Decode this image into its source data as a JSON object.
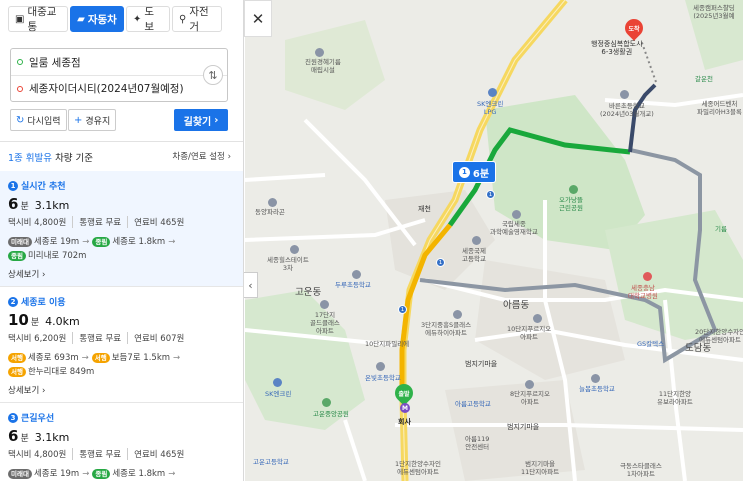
{
  "tabs": [
    {
      "label": "대중교통",
      "icon": "bus-icon",
      "glyph": "▣",
      "active": false
    },
    {
      "label": "자동차",
      "icon": "car-icon",
      "glyph": "▰",
      "active": true
    },
    {
      "label": "도보",
      "icon": "walk-icon",
      "glyph": "🚶",
      "active": false
    },
    {
      "label": "자전거",
      "icon": "bike-icon",
      "glyph": "⚲",
      "active": false
    }
  ],
  "search": {
    "origin": "일룸 세종점",
    "destination": "세종자이더시티(2024년07월예정)"
  },
  "buttons": {
    "reset": "다시입력",
    "waypoint": "경유지",
    "go": "길찾기"
  },
  "criteria": {
    "vehicle_class": "1종 휘발유",
    "suffix": "차량 기준",
    "settings": "차종/연료 설정"
  },
  "routes": [
    {
      "num": "1",
      "title": "실시간 추천",
      "time": "6",
      "time_unit": "분",
      "distance": "3.1km",
      "taxi": "택시비 4,800원",
      "toll": "통행료 무료",
      "fuel": "연료비 465원",
      "roads": [
        {
          "tag": "미래대",
          "tag_color": "gray",
          "text": "세종로 19m"
        },
        {
          "tag": "종림",
          "tag_color": "green",
          "text": "세종로 1.8km"
        },
        {
          "tag": "종림",
          "tag_color": "green",
          "text": "미리내로 702m"
        }
      ],
      "detail": "상세보기"
    },
    {
      "num": "2",
      "title": "세종로 이용",
      "time": "10",
      "time_unit": "분",
      "distance": "4.0km",
      "taxi": "택시비 6,200원",
      "toll": "통행료 무료",
      "fuel": "연료비 607원",
      "roads": [
        {
          "tag": "서행",
          "tag_color": "orange",
          "text": "세종로 693m"
        },
        {
          "tag": "서행",
          "tag_color": "orange",
          "text": "보듬7로 1.5km"
        },
        {
          "tag": "서행",
          "tag_color": "orange",
          "text": "한누리대로 849m"
        }
      ],
      "detail": "상세보기"
    },
    {
      "num": "3",
      "title": "큰길우선",
      "time": "6",
      "time_unit": "분",
      "distance": "3.1km",
      "taxi": "택시비 4,800원",
      "toll": "통행료 무료",
      "fuel": "연료비 465원",
      "roads": [
        {
          "tag": "미래대",
          "tag_color": "gray",
          "text": "세종로 19m"
        },
        {
          "tag": "종림",
          "tag_color": "green",
          "text": "세종로 1.8km"
        }
      ],
      "detail": ""
    }
  ],
  "map": {
    "route_time_badge": {
      "num": "1",
      "text": "6분"
    },
    "dest_pin": "도착",
    "start_pin": "출발",
    "start_place": "회사",
    "labels": {
      "l1": "진원경혜기름\n매립시설",
      "l2": "행정중심복합도시\n6-3생활권",
      "l3": "SK엔크린\nLPG",
      "l4": "바른초등학교\n(2024년03월개교)",
      "l5": "갈운천",
      "l6": "세종캠퍼스챨딩\n(2025년3월예",
      "l7": "세종어드벤처\n파밀리아H3블록",
      "l8": "오가낭뜰\n근린공원",
      "l9": "국립세종\n과학예술영재학교",
      "l10": "세종국제\n고등학교",
      "l11": "동양파라곤",
      "l12": "세종힐스테이트\n3차",
      "l13": "재천",
      "l14": "고운동",
      "l15": "두루초등학교",
      "l16": "17단지\n골드클래스\n아파트",
      "l17": "3단지중흥S클래스\n에듀하이아파트",
      "l18": "10단지푸르지오\n아파트",
      "l19": "아름동",
      "l20": "세종충남\n대학교병원",
      "l21": "GS칼텍스",
      "l22": "도담동",
      "l23": "20단지한양수자인\n에듀센텀아파트",
      "l24": "범지기마을",
      "l25": "8단지푸르지오\n아파트",
      "l26": "아름고등학교",
      "l27": "늘봄초등학교",
      "l28": "11단지한양\n유보라아파트",
      "l29": "SK엔크린",
      "l30": "고운중앙공원",
      "l31": "온빛초등학교",
      "l32": "범지기마을",
      "l33": "아름119\n안전센터",
      "l34": "10단지파밀리에",
      "l35": "고운고등학교",
      "l36": "1단지한양수자인\n에듀센텀아파트",
      "l37": "범지기마을\n11단지아파트",
      "l38": "극동스타클래스\n1차아파트",
      "l39": "기름"
    }
  },
  "colors": {
    "accent": "#1a73e8",
    "route_green": "#19a83b",
    "route_yellow": "#f3b400",
    "route_gray": "#8c96a3",
    "dest_red": "#ea4335"
  }
}
